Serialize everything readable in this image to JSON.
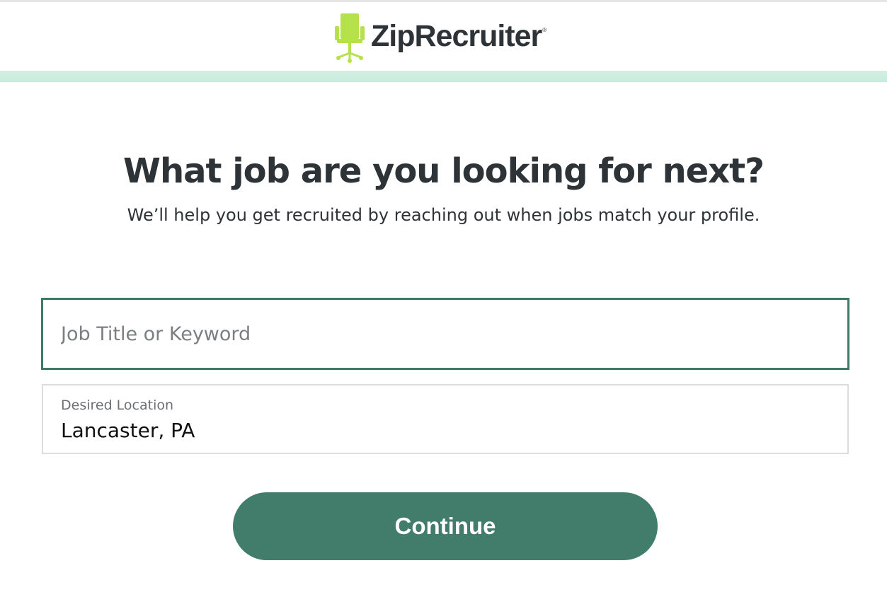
{
  "brand": {
    "name": "ZipRecruiter",
    "registered_mark": "®",
    "logo_icon": "office-chair-icon",
    "logo_color": "#b5e14b",
    "text_color": "#2d3336"
  },
  "main": {
    "title": "What job are you looking for next?",
    "subtitle": "We’ll help you get recruited by reaching out when jobs match your profile."
  },
  "form": {
    "job": {
      "value": "",
      "placeholder": "Job Title or Keyword"
    },
    "location": {
      "label": "Desired Location",
      "value": "Lancaster, PA"
    },
    "continue_label": "Continue"
  },
  "colors": {
    "accent": "#427c6a",
    "accent_bar": "#c6ebdd",
    "focus_border": "#3f7a66"
  }
}
